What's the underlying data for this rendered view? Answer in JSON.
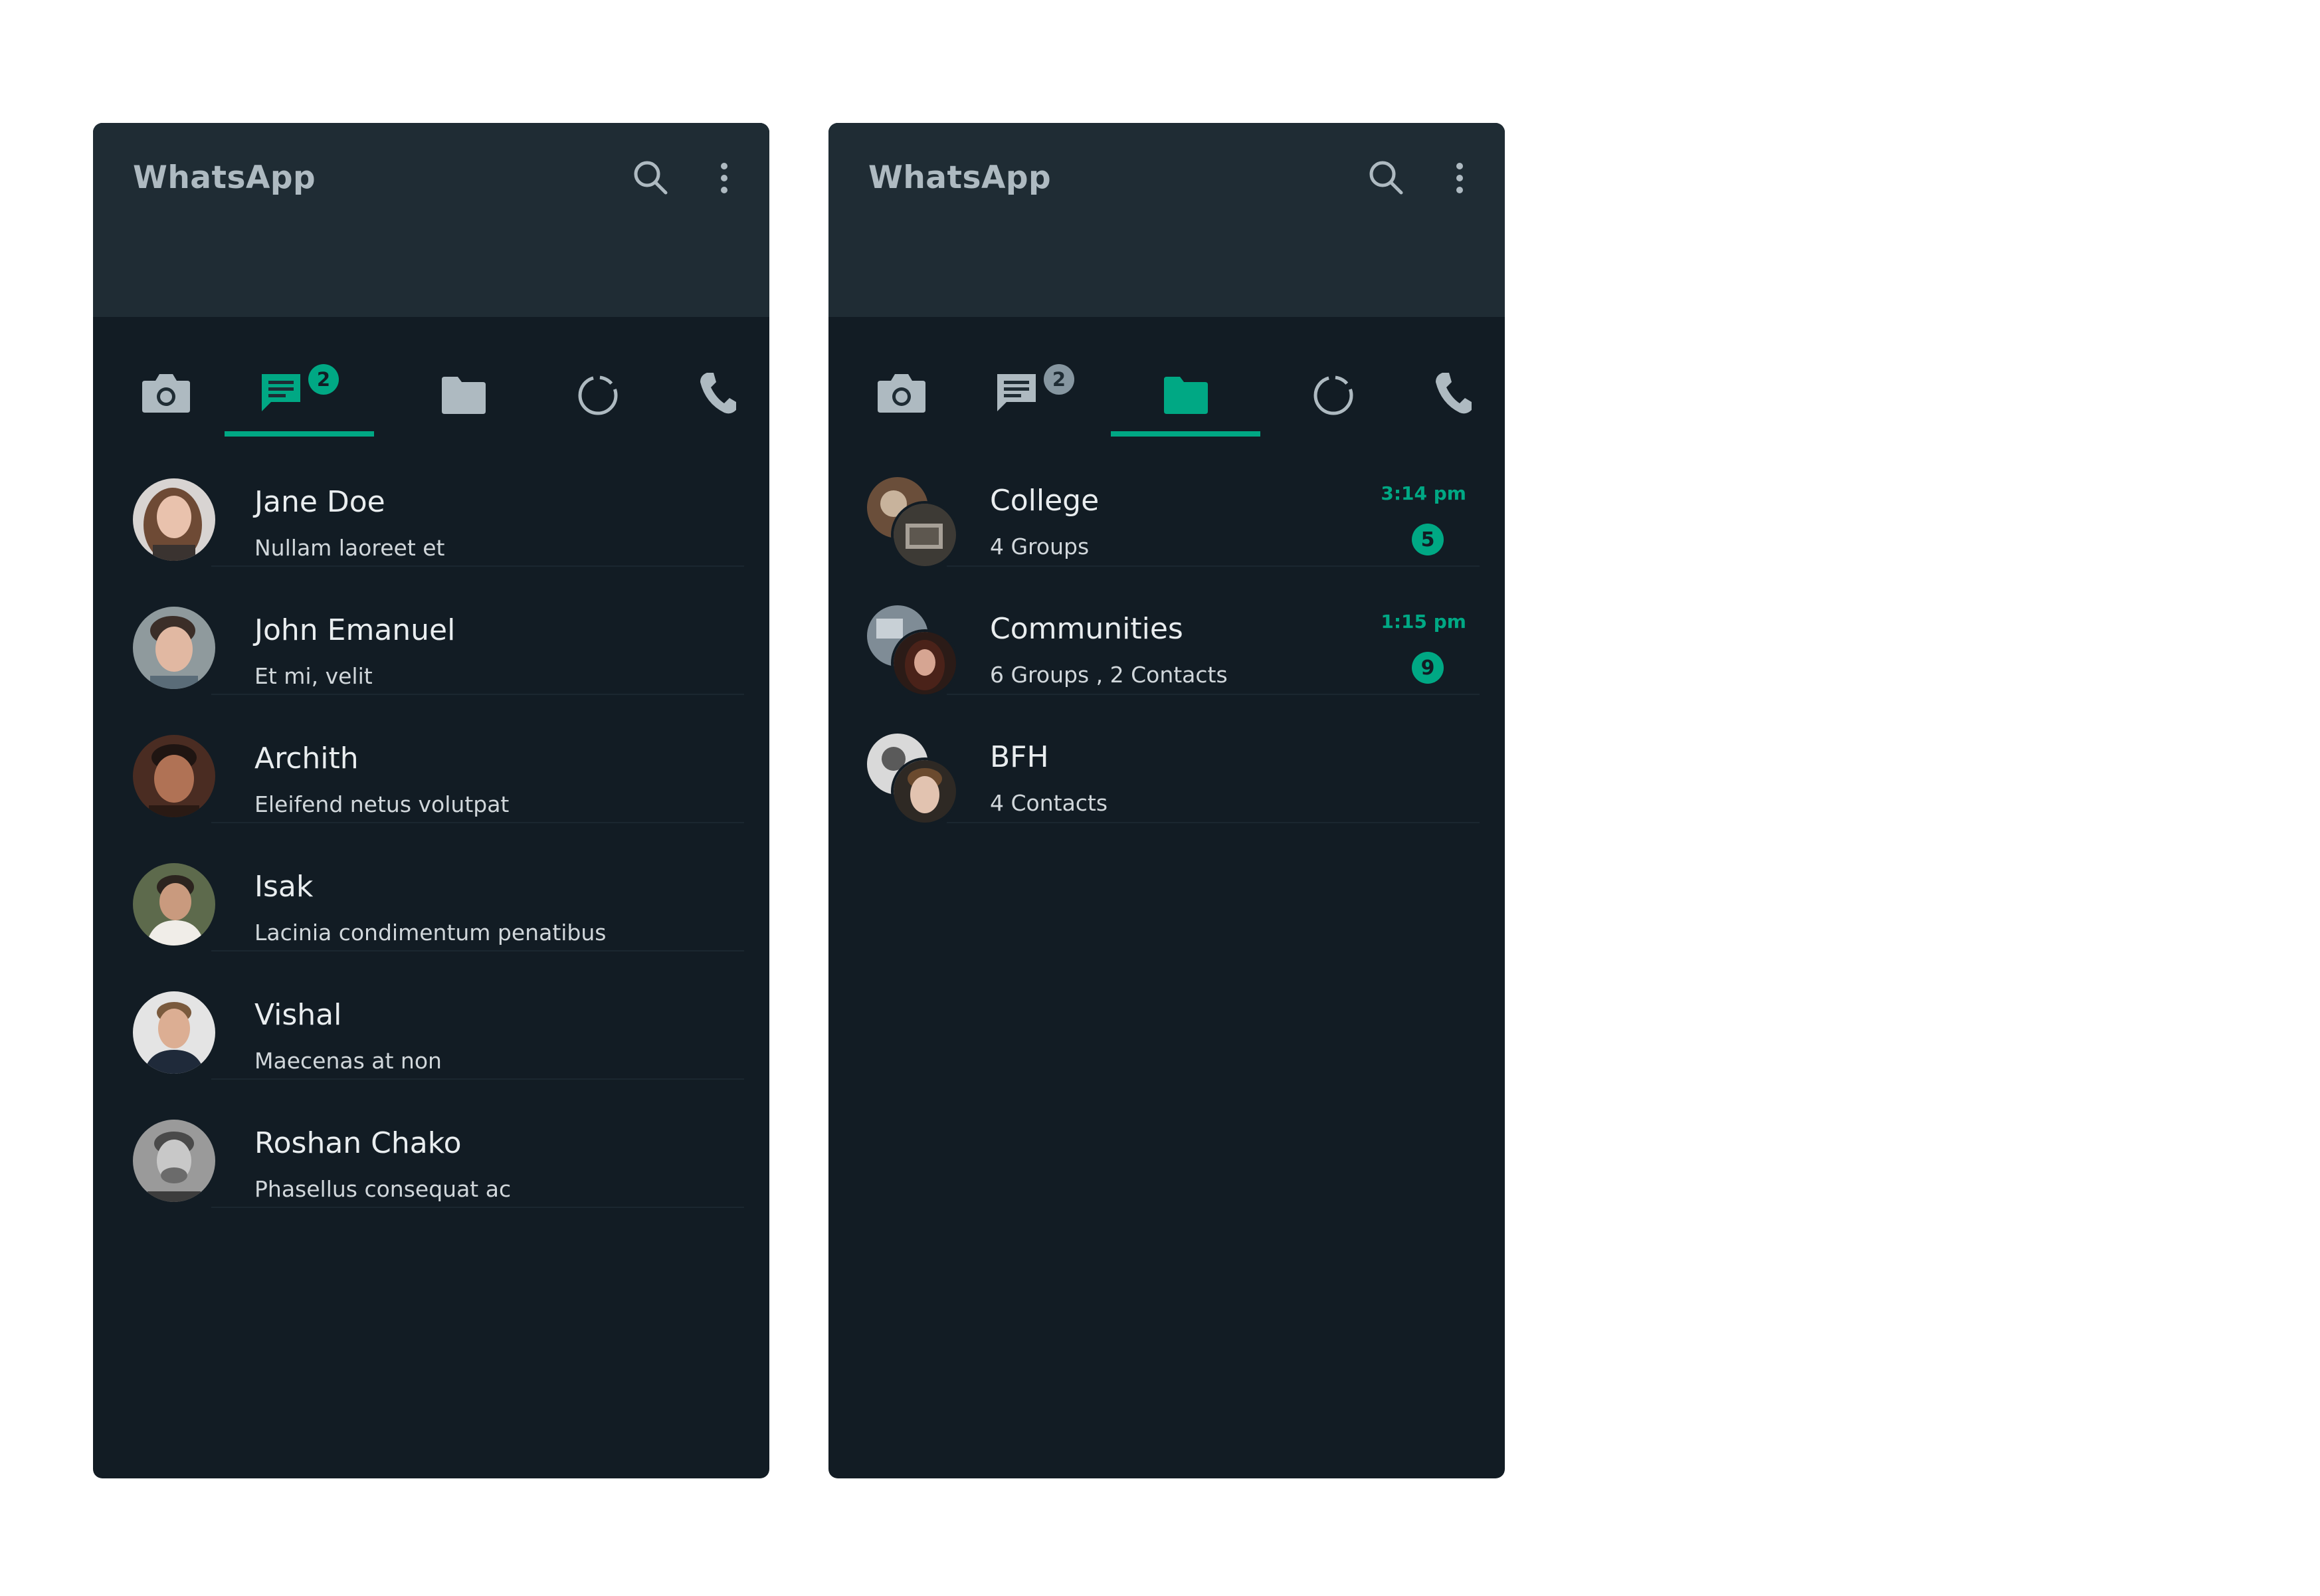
{
  "colors": {
    "accent": "#00a884",
    "header_bg": "#1f2c34",
    "list_bg": "#121c24",
    "icon_gray": "#aebac1",
    "text_primary": "#e9edef"
  },
  "left_screen": {
    "app_title": "WhatsApp",
    "tabs": [
      {
        "icon": "camera-icon"
      },
      {
        "icon": "chat-icon",
        "badge": "2",
        "active": true
      },
      {
        "icon": "communities-folder-icon"
      },
      {
        "icon": "status-icon"
      },
      {
        "icon": "phone-icon"
      }
    ],
    "chats": [
      {
        "name": "Jane Doe",
        "message": "Nullam laoreet et"
      },
      {
        "name": "John Emanuel",
        "message": "Et mi, velit"
      },
      {
        "name": "Archith",
        "message": "Eleifend netus volutpat"
      },
      {
        "name": "Isak",
        "message": "Lacinia condimentum penatibus"
      },
      {
        "name": "Vishal",
        "message": "Maecenas at non"
      },
      {
        "name": "Roshan Chako",
        "message": "Phasellus consequat ac"
      }
    ]
  },
  "right_screen": {
    "app_title": "WhatsApp",
    "tabs": [
      {
        "icon": "camera-icon"
      },
      {
        "icon": "chat-icon",
        "badge": "2"
      },
      {
        "icon": "communities-folder-icon",
        "active": true
      },
      {
        "icon": "status-icon"
      },
      {
        "icon": "phone-icon"
      }
    ],
    "communities": [
      {
        "name": "College",
        "summary": "4 Groups",
        "time": "3:14 pm",
        "unread": "5"
      },
      {
        "name": "Communities",
        "summary": "6 Groups , 2 Contacts",
        "time": "1:15 pm",
        "unread": "9"
      },
      {
        "name": "BFH",
        "summary": "4 Contacts"
      }
    ]
  }
}
